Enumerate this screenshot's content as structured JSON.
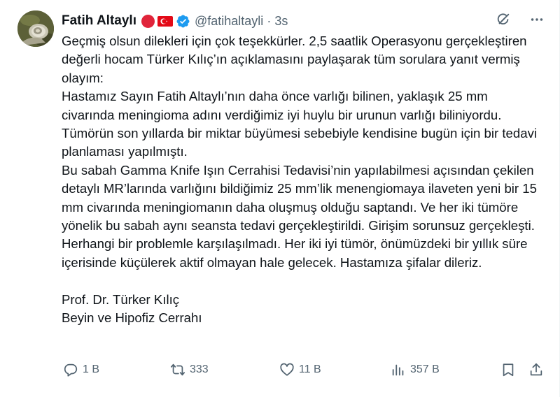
{
  "author": {
    "display_name": "Fatih Altaylı",
    "handle": "@fatihaltayli",
    "separator": "·",
    "time": "3s"
  },
  "tweet": {
    "paragraphs": [
      "Geçmiş olsun dilekleri için çok teşekkürler. 2,5 saatlik Operasyonu gerçekleştiren değerli hocam Türker Kılıç’ın açıklamasını paylaşarak tüm sorulara yanıt vermiş olayım:",
      "Hastamız Sayın Fatih Altaylı’nın daha önce varlığı bilinen, yaklaşık 25 mm civarında meningioma adını verdiğimiz iyi huylu bir urunun varlığı biliniyordu. Tümörün son yıllarda bir miktar büyümesi sebebiyle kendisine bugün için bir tedavi planlaması yapılmıştı.",
      "Bu sabah Gamma Knife Işın Cerrahisi Tedavisi’nin yapılabilmesi açısından çekilen detaylı MR’larında varlığını bildiğimiz 25 mm’lik menengiomaya ilaveten yeni bir 15 mm civarında meningiomanın daha oluşmuş olduğu saptandı. Ve her iki tümöre yönelik bu sabah aynı seansta tedavi gerçekleştirildi. Girişim sorunsuz gerçekleşti. Herhangi bir problemle karşılaşılmadı. Her iki iyi tümör, önümüzdeki bir yıllık süre içerisinde küçülerek aktif olmayan hale gelecek. Hastamıza şifalar dileriz."
    ],
    "signature_name": "Prof. Dr. Türker Kılıç",
    "signature_title": "Beyin ve Hipofiz Cerrahı"
  },
  "actions": {
    "replies": "1 B",
    "retweets": "333",
    "likes": "11 B",
    "views": "357 B"
  },
  "colors": {
    "text": "#0f1419",
    "muted": "#536471",
    "verified_blue": "#1d9bf0",
    "red_badge": "#e0243a"
  },
  "icons": {
    "grok": "grok-icon",
    "more": "more-icon",
    "reply": "reply-icon",
    "retweet": "retweet-icon",
    "like": "heart-icon",
    "views": "views-icon",
    "bookmark": "bookmark-icon",
    "share": "share-icon",
    "verified": "verified-icon",
    "flag": "turkey-flag-icon"
  }
}
